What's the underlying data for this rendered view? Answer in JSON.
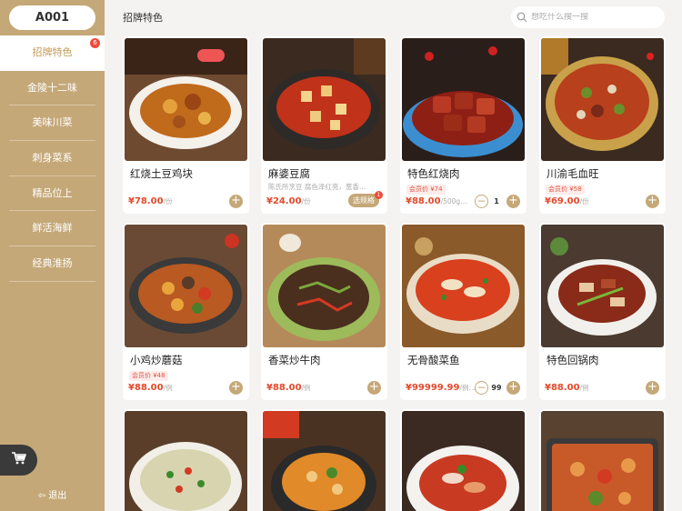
{
  "sidebar": {
    "table_no": "A001",
    "categories": [
      {
        "label": "招牌特色",
        "badge": "6"
      },
      {
        "label": "金陵十二味"
      },
      {
        "label": "美味川菜"
      },
      {
        "label": "刺身菜系"
      },
      {
        "label": "精品位上"
      },
      {
        "label": "鲜活海鲜"
      },
      {
        "label": "经典淮扬"
      }
    ],
    "logout_label": "退出"
  },
  "header": {
    "section_title": "招牌特色",
    "search_placeholder": "想吃什么搜一搜"
  },
  "dishes": [
    {
      "name": "红烧土豆鸡块",
      "price": "¥78.00",
      "unit": "/份"
    },
    {
      "name": "麻婆豆腐",
      "desc": "陈氏所烹豆 腐色泽红亮，葱香…",
      "price": "¥24.00",
      "unit": "/份",
      "spec_label": "选规格",
      "spec_badge": "1"
    },
    {
      "name": "特色红烧肉",
      "member_price": "会员价 ¥74",
      "price": "¥88.00",
      "unit": "/500g…",
      "qty": "1"
    },
    {
      "name": "川渝毛血旺",
      "member_price": "会员价 ¥58",
      "price": "¥69.00",
      "unit": "/份"
    },
    {
      "name": "小鸡炒蘑菇",
      "member_price": "会员价 ¥48",
      "price": "¥88.00",
      "unit": "/例"
    },
    {
      "name": "香菜炒牛肉",
      "price": "¥88.00",
      "unit": "/例"
    },
    {
      "name": "无骨酸菜鱼",
      "price": "¥99999.99",
      "unit": "/例…",
      "qty": "99"
    },
    {
      "name": "特色回锅肉",
      "price": "¥88.00",
      "unit": "/例"
    },
    {
      "name": ""
    },
    {
      "name": ""
    },
    {
      "name": ""
    },
    {
      "name": ""
    }
  ],
  "colors": {
    "accent": "#c5a878",
    "price": "#e34a2c",
    "badge": "#ef4b3a"
  }
}
